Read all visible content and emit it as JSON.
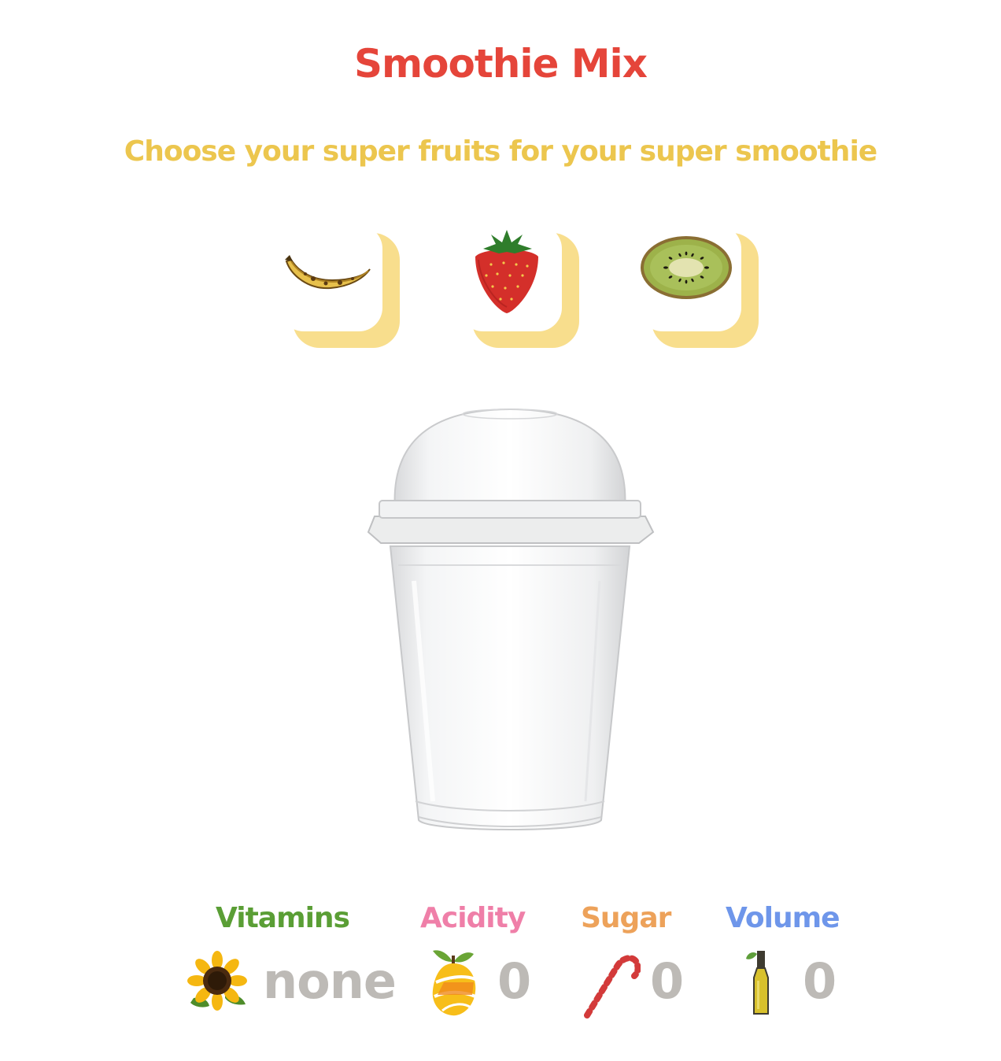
{
  "header": {
    "title": "Smoothie Mix",
    "subtitle": "Choose your super fruits for your super smoothie"
  },
  "fruits": [
    {
      "name": "banana",
      "icon": "banana-icon"
    },
    {
      "name": "strawberry",
      "icon": "strawberry-icon"
    },
    {
      "name": "kiwi",
      "icon": "kiwi-icon"
    }
  ],
  "stats": {
    "vitamins": {
      "label": "Vitamins",
      "value": "none",
      "icon": "sunflower-icon",
      "color": "#5a9e35"
    },
    "acidity": {
      "label": "Acidity",
      "value": "0",
      "icon": "lemon-icon",
      "color": "#ef7fa8"
    },
    "sugar": {
      "label": "Sugar",
      "value": "0",
      "icon": "candy-cane-icon",
      "color": "#eda25a"
    },
    "volume": {
      "label": "Volume",
      "value": "0",
      "icon": "bottle-icon",
      "color": "#6e96ea"
    }
  },
  "colors": {
    "title": "#e5453a",
    "subtitle": "#ecc64e",
    "card_accent": "#f8de8d",
    "value_gray": "#bdbab6"
  }
}
